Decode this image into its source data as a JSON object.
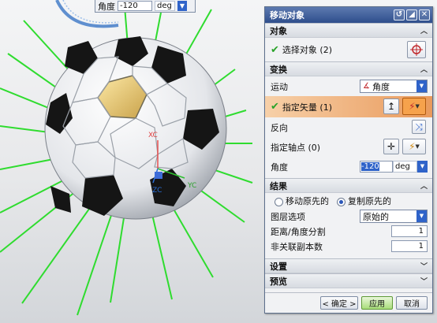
{
  "viewport": {
    "float_angle": {
      "label": "角度",
      "value": "-120",
      "unit": "deg"
    },
    "axis_labels": {
      "x": "XC",
      "y": "YC",
      "z": "ZC"
    }
  },
  "dialog": {
    "title": "移动对象",
    "title_buttons": [
      "reset-icon",
      "pin-icon",
      "close-icon"
    ],
    "object_group": {
      "header": "对象",
      "select_label": "选择对象 (2)"
    },
    "transform_group": {
      "header": "变换",
      "motion_label": "运动",
      "motion_value": "角度",
      "vector_label": "指定矢量 (1)",
      "reverse_label": "反向",
      "pivot_label": "指定轴点 (0)",
      "angle_label": "角度",
      "angle_value": "-120",
      "angle_unit": "deg"
    },
    "result_group": {
      "header": "结果",
      "radio_move": "移动原先的",
      "radio_copy": "复制原先的",
      "selected_radio": "复制原先的",
      "layer_label": "图层选项",
      "layer_value": "原始的",
      "distance_label": "距离/角度分割",
      "distance_value": "1",
      "copies_label": "非关联副本数",
      "copies_value": "1"
    },
    "settings_header": "设置",
    "preview_header": "预览",
    "buttons": {
      "ok": "< 确定 >",
      "apply": "应用",
      "cancel": "取消"
    }
  },
  "colors": {
    "titlebar": "#2e4e8c",
    "highlight": "#f1b787",
    "accent": "#2f63c9",
    "green_rays": "#2fdc2f"
  }
}
